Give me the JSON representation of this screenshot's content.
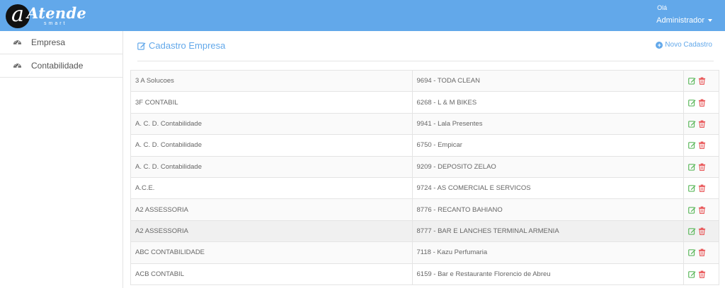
{
  "header": {
    "logo_text": "Atende",
    "logo_sub": "smart",
    "greeting": "Olá",
    "user_name": "Administrador",
    "color": "#62a8ea"
  },
  "sidebar": {
    "items": [
      {
        "label": "Empresa",
        "icon": "dashboard-gauge-icon"
      },
      {
        "label": "Contabilidade",
        "icon": "dashboard-gauge-icon"
      }
    ]
  },
  "main": {
    "title": "Cadastro Empresa",
    "title_icon": "edit-icon",
    "new_label": "Novo Cadastro",
    "new_icon": "plus-circle-icon"
  },
  "table": {
    "rows": [
      {
        "contabilidade": "3 A Solucoes",
        "empresa": "9694 - TODA CLEAN"
      },
      {
        "contabilidade": "3F CONTABIL",
        "empresa": "6268 - L & M BIKES"
      },
      {
        "contabilidade": "A. C. D. Contabilidade",
        "empresa": "9941 - Lala Presentes"
      },
      {
        "contabilidade": "A. C. D. Contabilidade",
        "empresa": "6750 - Empicar"
      },
      {
        "contabilidade": "A. C. D. Contabilidade",
        "empresa": "9209 - DEPOSITO ZELAO"
      },
      {
        "contabilidade": "A.C.E.",
        "empresa": "9724 - AS COMERCIAL E SERVICOS"
      },
      {
        "contabilidade": "A2 ASSESSORIA",
        "empresa": "8776 - RECANTO BAHIANO"
      },
      {
        "contabilidade": "A2 ASSESSORIA",
        "empresa": "8777 - BAR E LANCHES TERMINAL ARMENIA"
      },
      {
        "contabilidade": "ABC CONTABILIDADE",
        "empresa": "7118 - Kazu Perfumaria"
      },
      {
        "contabilidade": "ACB CONTABIL",
        "empresa": "6159 - Bar e Restaurante Florencio de Abreu"
      }
    ],
    "edit_icon_color": "#5cb85c",
    "delete_icon_color": "#e9595b"
  }
}
